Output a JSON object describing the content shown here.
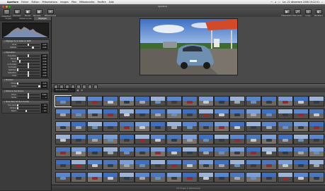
{
  "menubar": {
    "items": [
      "Aperture",
      "Fichier",
      "Édition",
      "Présentations",
      "Images",
      "Piles",
      "Métadonnées",
      "Fenêtre",
      "Aide"
    ],
    "clock": "lun. 22 décembre 2008  19:22:51",
    "right_icons": [
      "wifi-icon",
      "volume-icon",
      "battery-icon",
      "spotlight-icon"
    ]
  },
  "window": {
    "title": "Aperture"
  },
  "toolbar": {
    "left_buttons": [
      "Inspecteur",
      "Nouveau",
      "Nouvel",
      "Nouvelle sélection",
      "Métadonnées"
    ],
    "right_buttons": [
      "Présentation",
      "Plein écran",
      "Loupe",
      "Noir/Blanc"
    ]
  },
  "inspector": {
    "tabs": [
      "Projets",
      "Métadonnées",
      "Réglages"
    ],
    "active_tab": 2,
    "sections": [
      {
        "title": "Réglage de la balance RAW",
        "rows": [
          {
            "label": "Bruit",
            "value": "0,00",
            "pos": 0.5
          },
          {
            "label": "Netteté",
            "value": "0,80",
            "pos": 0.7
          }
        ]
      },
      {
        "title": "Exposition",
        "rows": [
          {
            "label": "Exposition",
            "value": "0,00",
            "pos": 0.5
          },
          {
            "label": "Récup.",
            "value": "0,00",
            "pos": 0.0
          },
          {
            "label": "Noirs",
            "value": "0,00",
            "pos": 0.1
          },
          {
            "label": "Luminosité",
            "value": "0,00",
            "pos": 0.5
          },
          {
            "label": "Contraste",
            "value": "0,00",
            "pos": 0.5
          },
          {
            "label": "Définition",
            "value": "0,00",
            "pos": 0.0
          },
          {
            "label": "Saturation",
            "value": "1,00",
            "pos": 0.5
          },
          {
            "label": "Éclat",
            "value": "0,00",
            "pos": 0.5
          }
        ]
      },
      {
        "title": "Niveaux",
        "rows": [
          {
            "label": "Entrée",
            "value": "0,00",
            "pos": 0.0
          },
          {
            "label": "Sortie",
            "value": "1,00",
            "pos": 1.0
          }
        ]
      },
      {
        "title": "Balance des blancs",
        "rows": [
          {
            "label": "Temp.",
            "value": "5000",
            "pos": 0.5
          },
          {
            "label": "Teinte",
            "value": "0",
            "pos": 0.5
          }
        ]
      },
      {
        "title": "Tons clairs et tons foncés",
        "rows": [
          {
            "label": "Tons clairs",
            "value": "0,0",
            "pos": 0.0
          },
          {
            "label": "Ombres",
            "value": "0,0",
            "pos": 0.0
          },
          {
            "label": "Rayon",
            "value": "0,0",
            "pos": 0.4
          }
        ]
      }
    ]
  },
  "browser": {
    "search_placeholder": "Tous les fichiers",
    "status": "123 images (1 sélectionnée)",
    "columns": 17,
    "rows": 7,
    "selected_index": 0
  },
  "colors": {
    "accent": "#4a7fd6",
    "app_bg": "#2b2b2b",
    "panel_bg": "#3b3b3b"
  }
}
